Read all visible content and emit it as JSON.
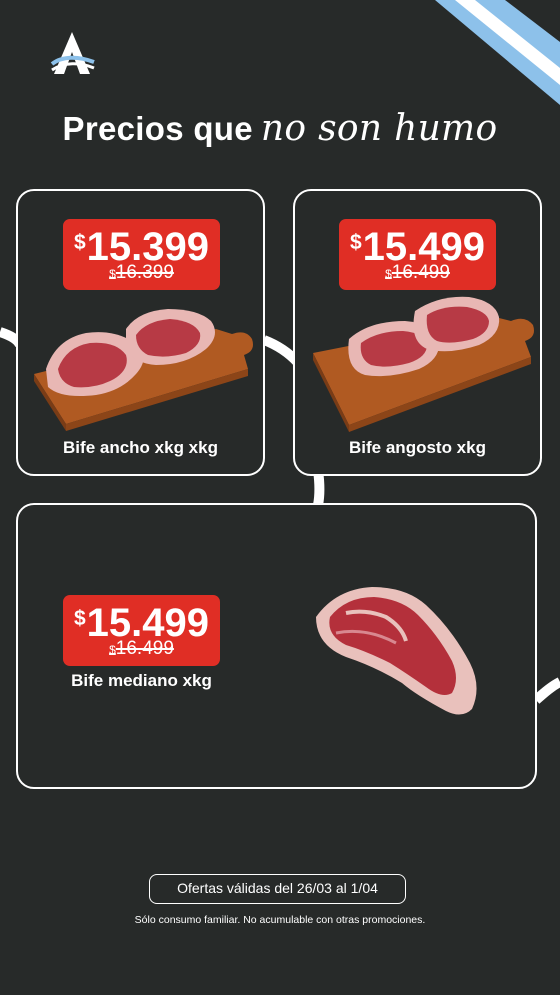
{
  "colors": {
    "background": "#272a29",
    "price_tag": "#e02e25",
    "text": "#ffffff",
    "flag_blue": "#8dc1ea"
  },
  "brand": {
    "logo_icon": "brand-a-logo-icon",
    "flag_icon": "argentina-flag-ribbon-icon"
  },
  "headline": {
    "text": "Precios que",
    "script_text": "no son humo"
  },
  "products": [
    {
      "currency": "$",
      "price": "15.399",
      "old_currency": "$",
      "old_price": "16.399",
      "name": "Bife ancho xkg xkg",
      "image_icon": "steaks-on-board-image"
    },
    {
      "currency": "$",
      "price": "15.499",
      "old_currency": "$",
      "old_price": "16.499",
      "name": "Bife angosto xkg",
      "image_icon": "steaks-on-board-image"
    },
    {
      "currency": "$",
      "price": "15.499",
      "old_currency": "$",
      "old_price": "16.499",
      "name": "Bife mediano xkg",
      "image_icon": "single-steak-image"
    }
  ],
  "footer": {
    "validity": "Ofertas válidas del 26/03 al 1/04",
    "disclaimer": "Sólo consumo familiar. No acumulable con otras promociones."
  }
}
